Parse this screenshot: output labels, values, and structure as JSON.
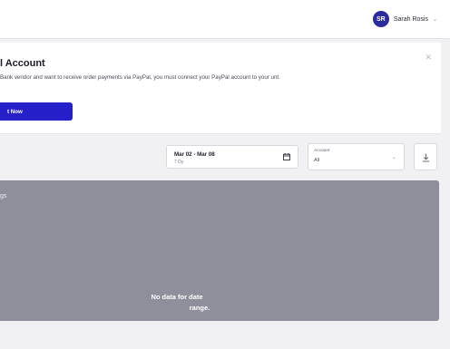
{
  "header": {
    "user": {
      "initials": "SR",
      "name": "Sarah Rosis",
      "chevron": "chevron-down-icon"
    }
  },
  "notice": {
    "title": "l Account",
    "body": "Bank vendor and want to receive order payments via PayPal, you must connect your PayPal account to your unt.",
    "close_icon": "close-icon",
    "button_label": "t Now"
  },
  "filters": {
    "date": {
      "range": "Mar 02 - Mar 08",
      "sub": "7 Dy",
      "icon": "calendar-icon"
    },
    "account": {
      "label": "Account",
      "value": "All",
      "icon": "chevron-down-icon"
    },
    "download_icon": "download-icon"
  },
  "chart_panel": {
    "title": "gs",
    "empty_line1": "No data for date",
    "empty_line2": "range."
  },
  "colors": {
    "accent": "#2520c9",
    "avatar": "#2b2a9e",
    "panel": "#8f8e9b",
    "background": "#f1f1f4"
  }
}
